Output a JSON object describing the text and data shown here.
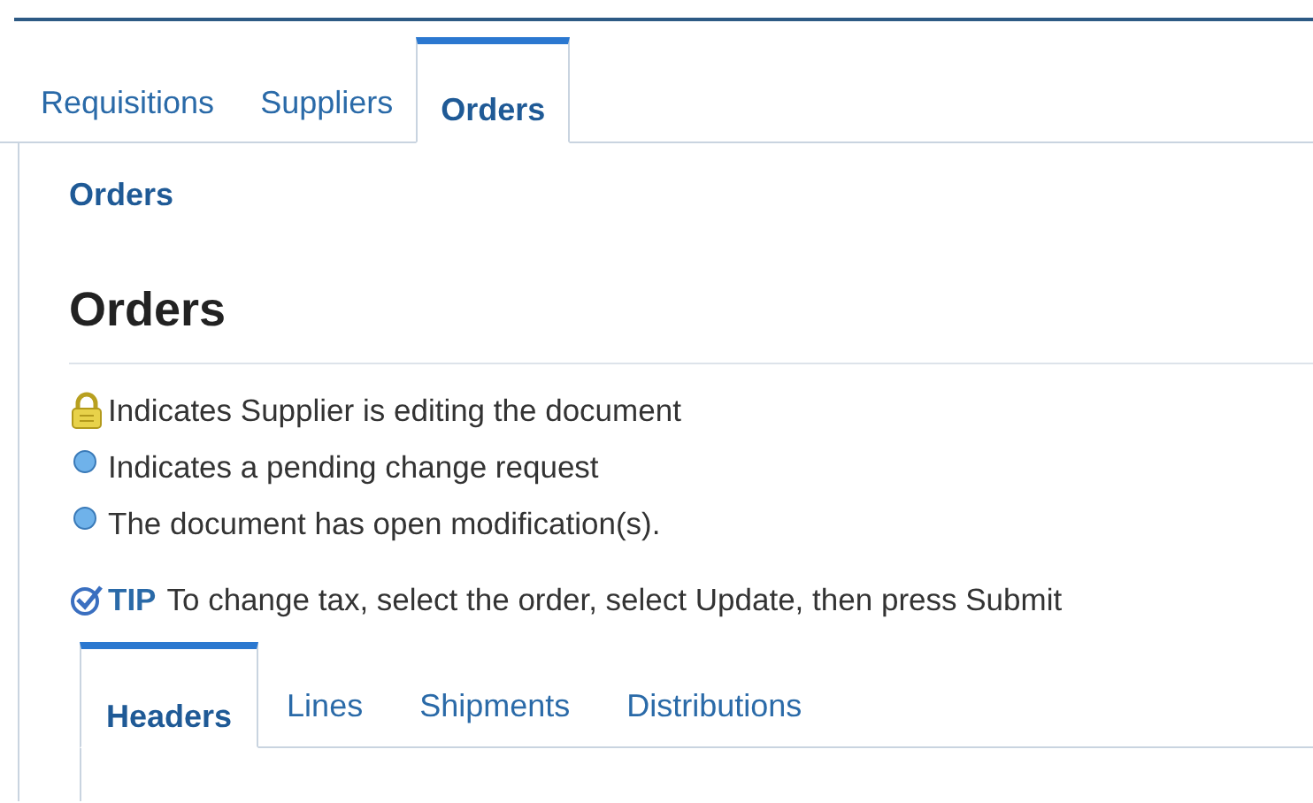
{
  "tabs": [
    {
      "label": "Requisitions",
      "selected": false
    },
    {
      "label": "Suppliers",
      "selected": false
    },
    {
      "label": "Orders",
      "selected": true
    }
  ],
  "breadcrumb": "Orders",
  "heading": "Orders",
  "legend": [
    {
      "kind": "lock",
      "text": "Indicates Supplier is editing the document"
    },
    {
      "kind": "dot",
      "text": "Indicates a pending change request"
    },
    {
      "kind": "dot",
      "text": "The document has open modification(s)."
    }
  ],
  "tip": {
    "label": "TIP",
    "text": "To change tax, select the order, select Update, then press Submit"
  },
  "sub_tabs": [
    {
      "label": "Headers",
      "selected": true
    },
    {
      "label": "Lines",
      "selected": false
    },
    {
      "label": "Shipments",
      "selected": false
    },
    {
      "label": "Distributions",
      "selected": false
    }
  ]
}
